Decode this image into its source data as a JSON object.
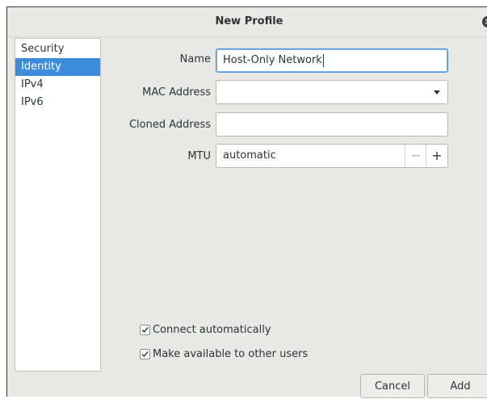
{
  "dialog": {
    "title": "New Profile"
  },
  "sidebar": {
    "items": [
      {
        "label": "Security",
        "selected": false
      },
      {
        "label": "Identity",
        "selected": true
      },
      {
        "label": "IPv4",
        "selected": false
      },
      {
        "label": "IPv6",
        "selected": false
      }
    ]
  },
  "form": {
    "name": {
      "label": "Name",
      "value": "Host-Only Network"
    },
    "mac": {
      "label": "MAC Address",
      "value": ""
    },
    "cloned": {
      "label": "Cloned Address",
      "value": ""
    },
    "mtu": {
      "label": "MTU",
      "value": "automatic",
      "minus": "−",
      "plus": "+"
    }
  },
  "options": {
    "connect_auto": {
      "label": "Connect automatically",
      "checked": true
    },
    "available_all": {
      "label": "Make available to other users",
      "checked": true
    }
  },
  "buttons": {
    "cancel": "Cancel",
    "add": "Add"
  },
  "colors": {
    "accent": "#3b8ddb",
    "window_bg": "#e8e8e7"
  }
}
